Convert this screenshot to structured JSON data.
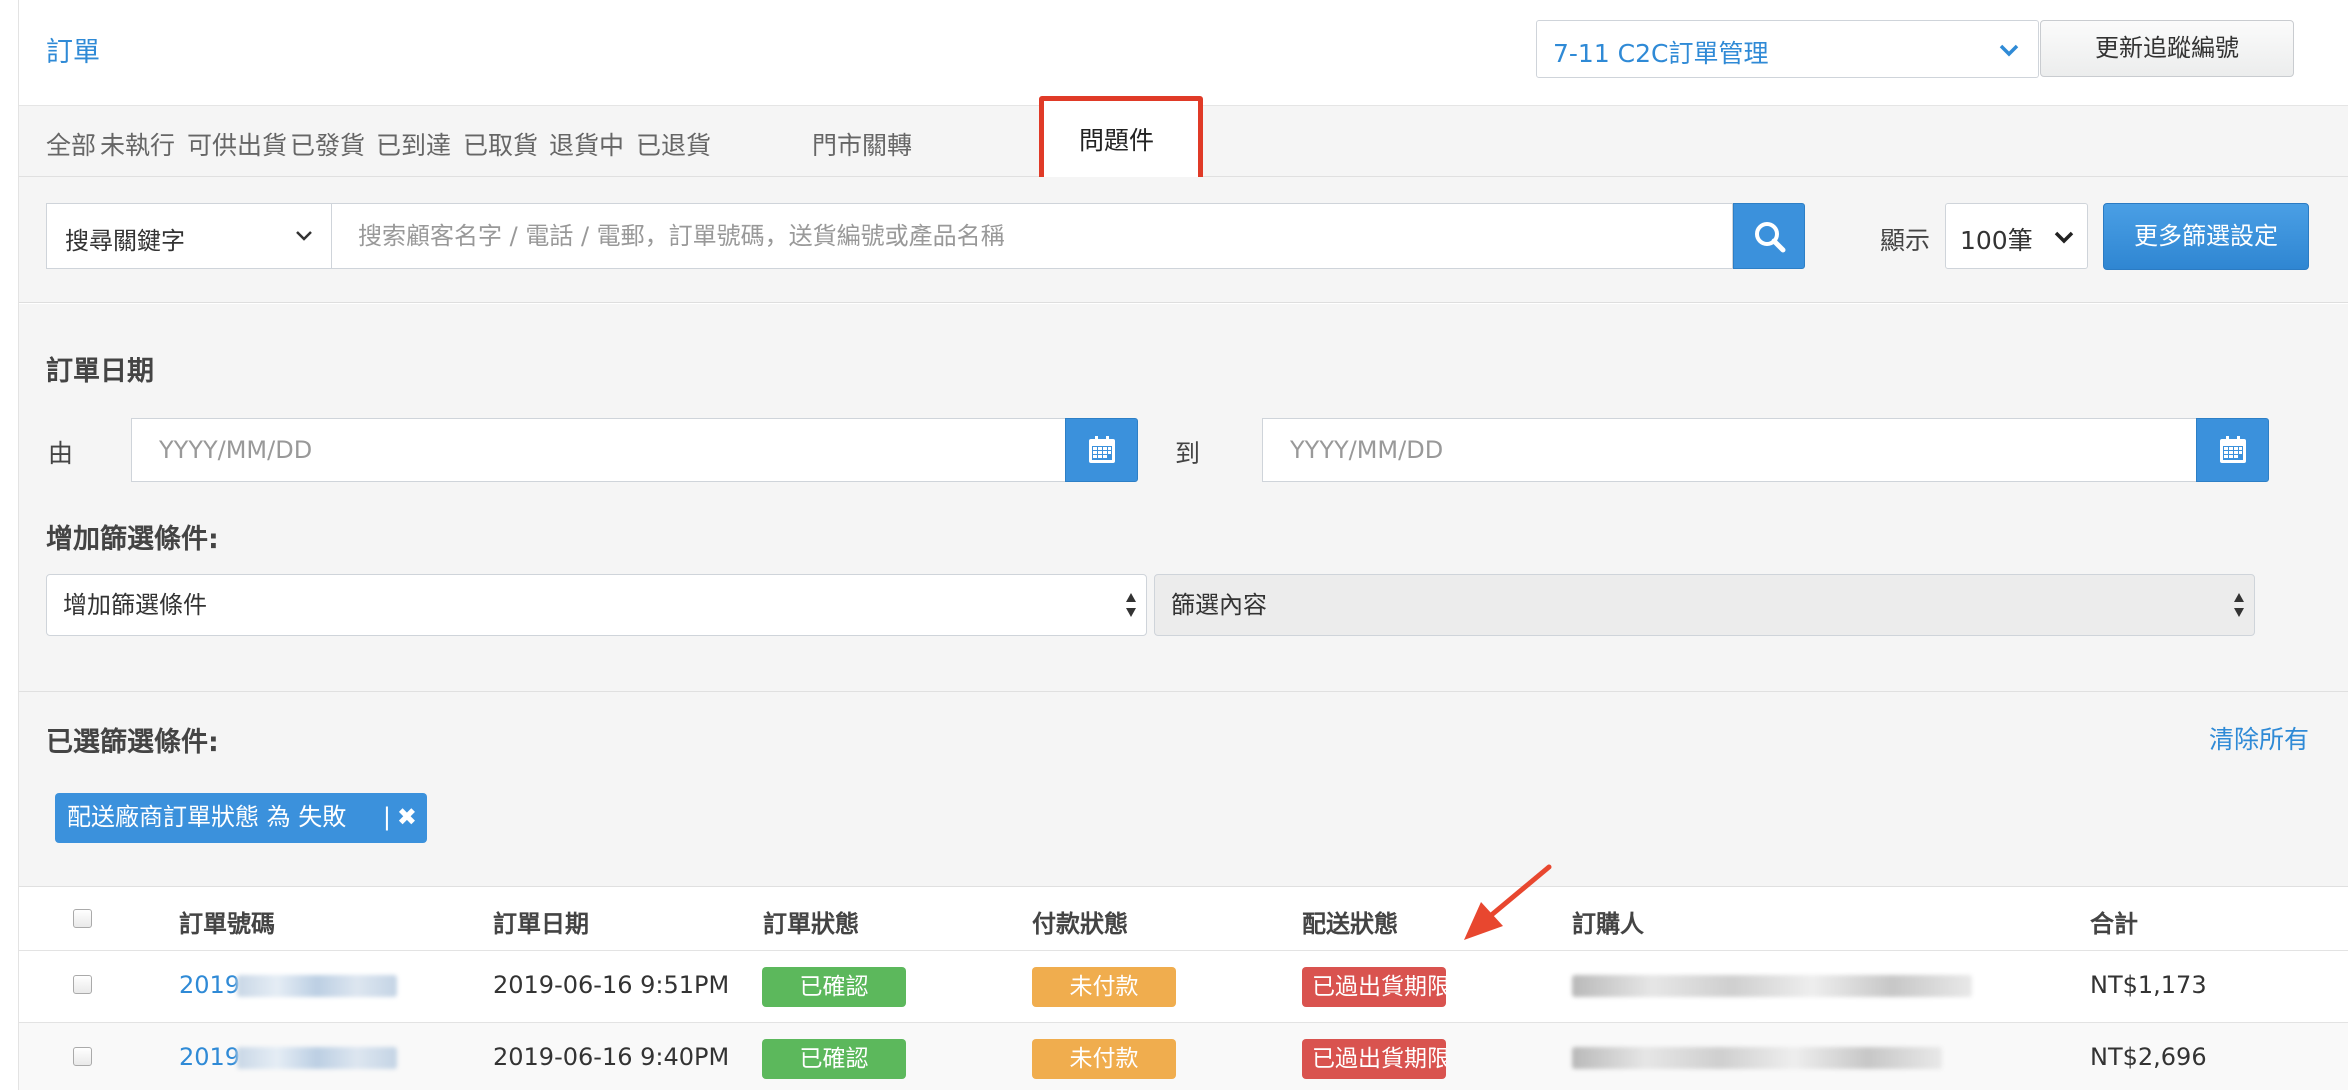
{
  "header": {
    "title": "訂單",
    "store_select": "7-11 C2C訂單管理",
    "update_button": "更新追蹤編號"
  },
  "tabs": [
    {
      "label": "全部"
    },
    {
      "label": "未執行"
    },
    {
      "label": "可供出貨"
    },
    {
      "label": "已發貨"
    },
    {
      "label": "已到達"
    },
    {
      "label": "已取貨"
    },
    {
      "label": "退貨中"
    },
    {
      "label": "已退貨"
    },
    {
      "label": "問題件",
      "active": true
    },
    {
      "label": "門市關轉"
    }
  ],
  "search": {
    "keyword_select": "搜尋關鍵字",
    "placeholder": "搜索顧客名字 / 電話 / 電郵，訂單號碼，送貨編號或產品名稱",
    "show_label": "顯示",
    "show_select": "100筆",
    "more_filter_button": "更多篩選設定"
  },
  "date_filter": {
    "label": "訂單日期",
    "from_label": "由",
    "to_label": "到",
    "from_placeholder": "YYYY/MM/DD",
    "to_placeholder": "YYYY/MM/DD"
  },
  "add_condition": {
    "label": "增加篩選條件:",
    "condition_select": "增加篩選條件",
    "content_select": "篩選內容"
  },
  "selected_filters": {
    "label": "已選篩選條件:",
    "clear_all": "清除所有",
    "chips": [
      "配送廠商訂單狀態 為 失敗"
    ]
  },
  "table": {
    "headers": [
      "訂單號碼",
      "訂單日期",
      "訂單狀態",
      "付款狀態",
      "配送狀態",
      "訂購人",
      "合計"
    ],
    "rows": [
      {
        "order_no": "2019",
        "date": "2019-06-16 9:51PM",
        "order_status": "已確認",
        "payment_status": "未付款",
        "delivery_status": "已過出貨期限",
        "total": "NT$1,173"
      },
      {
        "order_no": "2019",
        "date": "2019-06-16 9:40PM",
        "order_status": "已確認",
        "payment_status": "未付款",
        "delivery_status": "已過出貨期限",
        "total": "NT$2,696"
      }
    ]
  },
  "colors": {
    "link_blue": "#2f8ad6",
    "primary_button": "#3b91dc",
    "highlight_box": "#e03a27",
    "status_green": "#5cb85c",
    "status_orange": "#f0ad4e",
    "status_red": "#d9534f"
  }
}
